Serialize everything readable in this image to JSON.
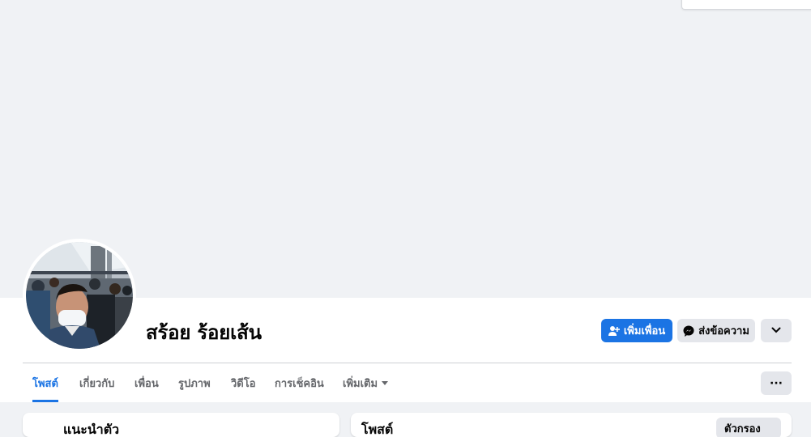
{
  "profile": {
    "name": "สร้อย ร้อยเส้น"
  },
  "actions": {
    "add_friend": "เพิ่มเพื่อน",
    "message": "ส่งข้อความ",
    "more_icon": "chevron-down-icon"
  },
  "tabs": [
    {
      "label": "โพสต์",
      "active": true
    },
    {
      "label": "เกี่ยวกับ",
      "active": false
    },
    {
      "label": "เพื่อน",
      "active": false
    },
    {
      "label": "รูปภาพ",
      "active": false
    },
    {
      "label": "วิดีโอ",
      "active": false
    },
    {
      "label": "การเช็คอิน",
      "active": false
    },
    {
      "label": "เพิ่มเติม",
      "active": false
    }
  ],
  "tab_overflow": "···",
  "cards": {
    "intro_title": "แนะนำตัว",
    "posts_title": "โพสต์",
    "filter_label": "ตัวกรอง"
  },
  "colors": {
    "accent": "#1b74e4",
    "background": "#f0f2f5",
    "secondary_button": "#e4e6eb"
  }
}
